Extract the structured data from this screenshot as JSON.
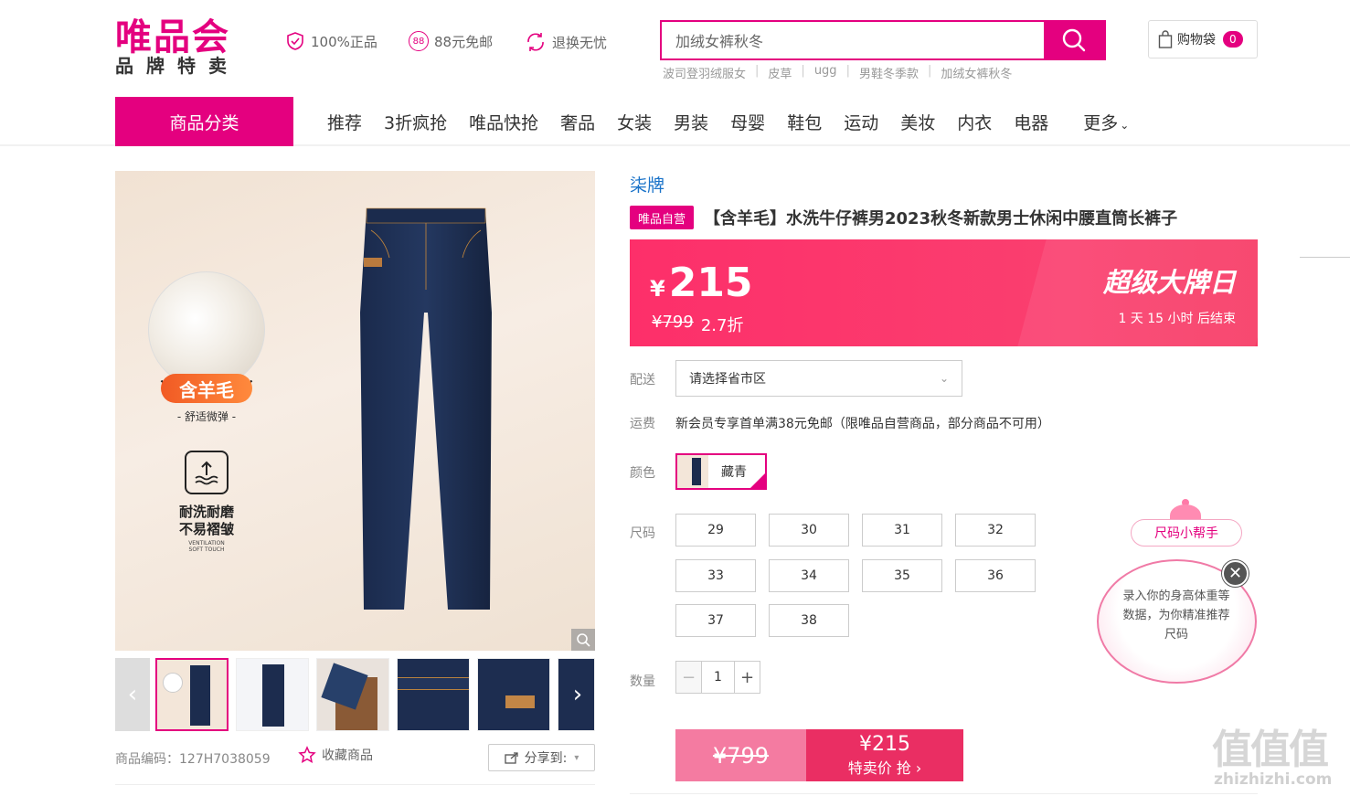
{
  "header": {
    "logo_main": "唯品会",
    "logo_sub": "品牌特卖",
    "promises": [
      {
        "icon": "shield-check-icon",
        "text": "100%正品"
      },
      {
        "icon": "free-shipping-88-icon",
        "text": "88元免邮"
      },
      {
        "icon": "refresh-icon",
        "text": "退换无忧"
      }
    ],
    "search": {
      "value": "加绒女裤秋冬"
    },
    "hot_words": [
      "波司登羽绒服女",
      "皮草",
      "ugg",
      "男鞋冬季款",
      "加绒女裤秋冬"
    ],
    "cart": {
      "label": "购物袋",
      "count": "0"
    }
  },
  "nav": {
    "category_label": "商品分类",
    "items": [
      "推荐",
      "3折疯抢",
      "唯品快抢",
      "奢品",
      "女装",
      "男装",
      "母婴",
      "鞋包",
      "运动",
      "美妆",
      "内衣",
      "电器"
    ],
    "more": "更多"
  },
  "gallery": {
    "badge_main": "含羊毛",
    "badge_sub": "- 舒适微弹 -",
    "feature_line1": "耐洗耐磨",
    "feature_line2": "不易褶皱",
    "feature_en1": "VENTILATION",
    "feature_en2": "SOFT TOUCH"
  },
  "bottom_bar": {
    "product_code": "商品编码：127H7038059",
    "favorite_label": "收藏商品",
    "share_label": "分享到:"
  },
  "product": {
    "brand": "柒牌",
    "tag": "唯品自营",
    "title": "【含羊毛】水洗牛仔裤男2023秋冬新款男士休闲中腰直筒长裤子",
    "price_symbol": "¥",
    "price": "215",
    "original_price": "¥799",
    "discount": "2.7折",
    "promo_title": "超级大牌日",
    "countdown": "1 天 15 小时 后结束",
    "delivery_label": "配送",
    "delivery_placeholder": "请选择省市区",
    "shipping_label": "运费",
    "shipping_text": "新会员专享首单满38元免邮（限唯品自营商品，部分商品不可用）",
    "color_label": "颜色",
    "color_name": "藏青",
    "size_label": "尺码",
    "sizes": [
      "29",
      "30",
      "31",
      "32",
      "33",
      "34",
      "35",
      "36",
      "37",
      "38"
    ],
    "qty_label": "数量",
    "qty": "1",
    "buy_original": "¥799",
    "buy_price": "¥215",
    "buy_label": "特卖价 抢 ›"
  },
  "size_helper": {
    "title": "尺码小帮手",
    "bubble": "录入你的身高体重等数据，为你精准推荐尺码"
  },
  "watermark": {
    "brand": "值值值",
    "url": "zhizhizhi.com"
  },
  "colors": {
    "accent": "#e4007f",
    "banner_start": "#fd2f6a",
    "banner_end": "#f73a64",
    "brand_link": "#1a73c9"
  }
}
